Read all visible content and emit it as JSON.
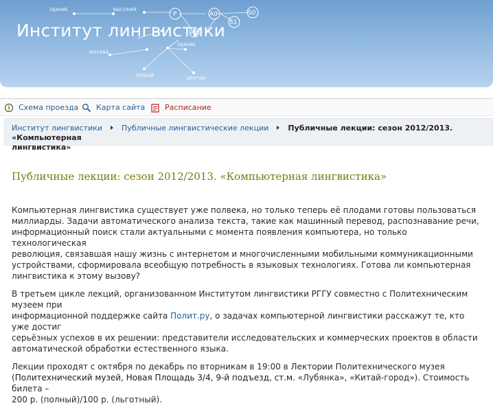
{
  "header": {
    "site_title": "Институт лингвистики",
    "graph_labels": {
      "zdanie_top": "ЗДАНИЕ",
      "vysokiy": "ВЫСОКИЙ",
      "moskva": "МОСКВА",
      "zdanie_mid": "ЗДАНИЕ",
      "lyuboy": "ЛЮБОЙ",
      "drugoy": "ДРУГОЙ",
      "node_p": "P",
      "node_a0": "A0",
      "node_s0": "S0",
      "node_s1": "S1",
      "node_a1": "A1"
    }
  },
  "toolbar": {
    "items": [
      {
        "label": "Схема проезда",
        "icon": "compass-icon"
      },
      {
        "label": "Карта сайта",
        "icon": "search-icon"
      },
      {
        "label": "Расписание",
        "icon": "schedule-icon"
      }
    ]
  },
  "breadcrumb": {
    "items": [
      "Институт лингвистики",
      "Публичные лингвистические лекции"
    ],
    "current_line1": "Публичные лекции: сезон 2012/2013. «Компьютерная",
    "current_line2": "лингвистика»"
  },
  "main": {
    "title": "Публичные лекции: сезон 2012/2013. «Компьютерная лингвистика»",
    "p1_lines": [
      "Компьютерная лингвистика существует уже полвека, но только теперь её плодами готовы пользоваться",
      "миллиарды. Задачи автоматического анализа текста, такие как машинный перевод,  распознавание речи,",
      "информационный поиск стали актуальными с момента появления компьютера, но только технологическая",
      "революция, связавшая нашу жизнь с интернетом и многочисленными мобильными коммуникационными",
      "устройствами, сформировала всеобщую потребность в языковых технологиях. Готова ли компьютерная",
      "лингвистика к этому вызову?"
    ],
    "p2_line1": "В третьем цикле лекций, организованном Институтом лингвистики РГГУ совместно с Политехническим музеем при",
    "p2_line2_before": "информационной поддержке сайта ",
    "p2_link": "Полит.ру",
    "p2_line2_after": ", о задачах компьютерной лингвистики расскажут те, кто уже достиг",
    "p2_line3": "серьёзных успехов в их решении: представители исследовательских и коммерческих проектов в области",
    "p2_line4": "автоматической обработки естественного языка.",
    "p3_line1": "Лекции проходят с октября по декабрь по вторникам в 19:00 в Лектории Политехнического музея",
    "p3_open": "(",
    "p3_addr": "Политехнический музей, Новая Площадь 3/4, 9-й подъезд, ст.м.",
    "p3_metro": " «Лубянка», «Китай-город»). Стоимость билета –",
    "p3_line3": "200 р. (полный)/100 р. (льготный)."
  }
}
